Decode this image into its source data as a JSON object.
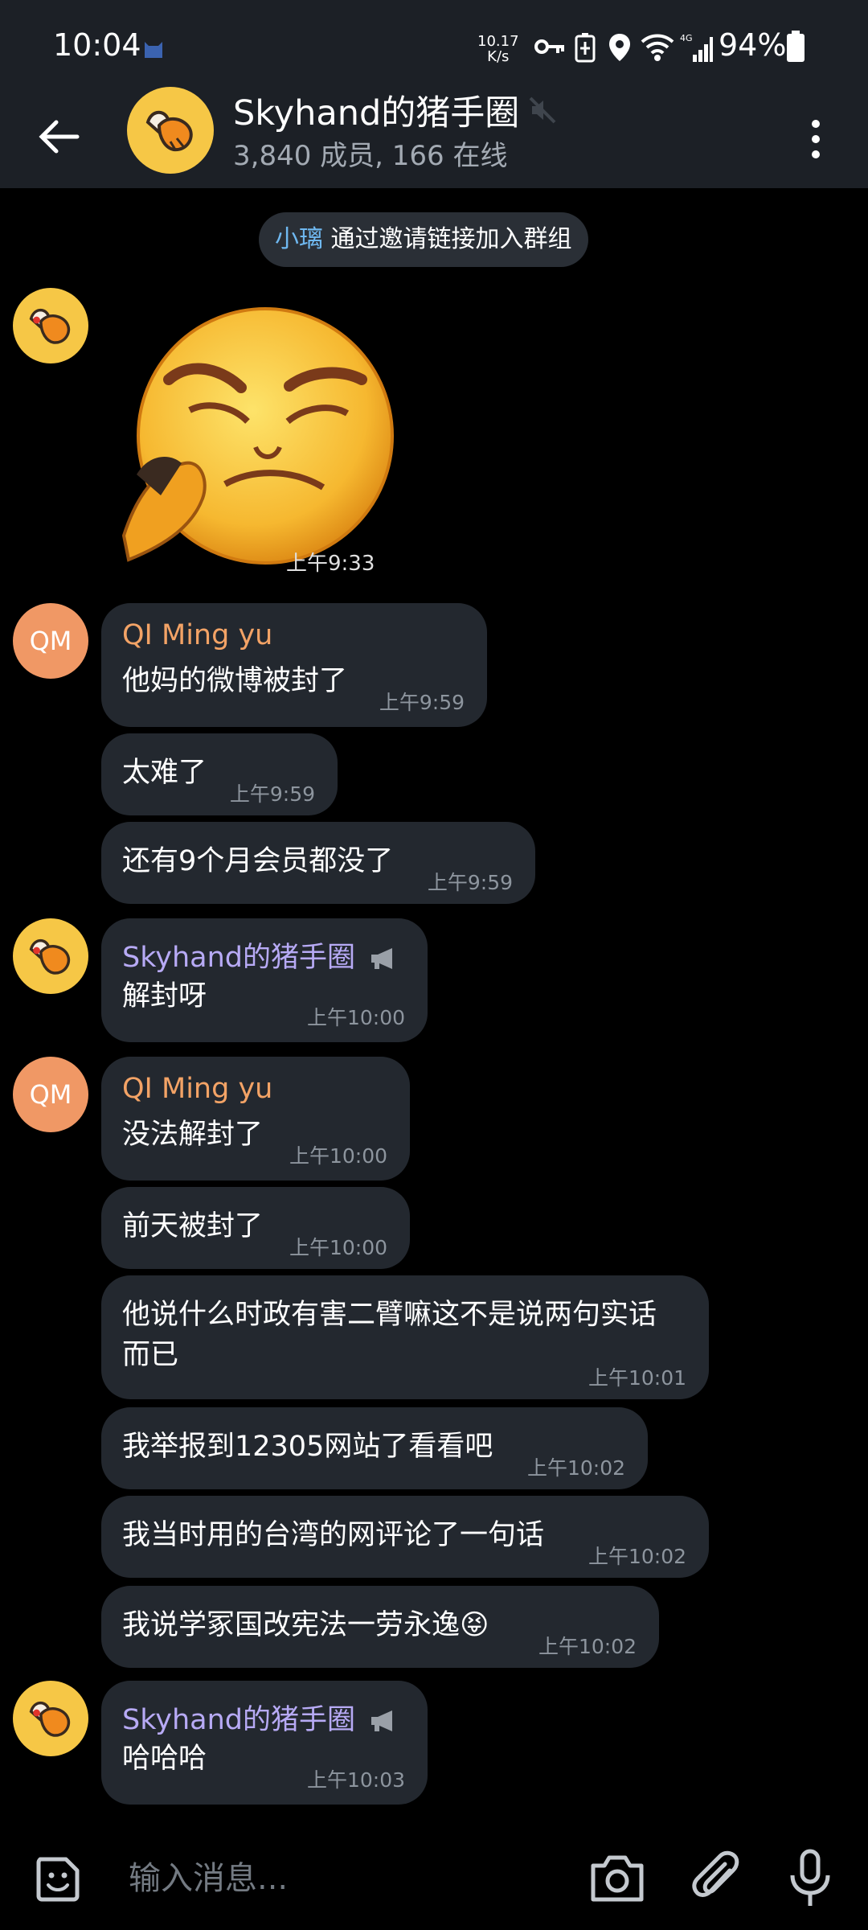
{
  "status_bar": {
    "time": "10:04",
    "net_speed_value": "10.17",
    "net_speed_unit": "K/s",
    "network": "4G",
    "battery": "94%"
  },
  "header": {
    "title": "Skyhand的猪手圈",
    "subtitle": "3,840 成员, 166 在线",
    "icons": [
      "back-arrow-icon",
      "mute-icon",
      "more-vert-icon"
    ]
  },
  "chat": {
    "service_message": {
      "name": "小璃",
      "text": "通过邀请链接加入群组"
    },
    "sticker": {
      "time": "上午9:33"
    },
    "messages": [
      {
        "sender": "QI Ming yu",
        "avatar": "QM",
        "text": "他妈的微博被封了",
        "time": "上午9:59"
      },
      {
        "text": "太难了",
        "time": "上午9:59"
      },
      {
        "text": "还有9个月会员都没了",
        "time": "上午9:59"
      },
      {
        "sender": "Skyhand的猪手圈",
        "text": "解封呀",
        "time": "上午10:00"
      },
      {
        "sender": "QI Ming yu",
        "avatar": "QM",
        "text": "没法解封了",
        "time": "上午10:00"
      },
      {
        "text": "前天被封了",
        "time": "上午10:00"
      },
      {
        "text_line1": "他说什么时政有害二臂嘛这不是说两句实话",
        "text_line2": "而已",
        "time": "上午10:01"
      },
      {
        "text": "我举报到12305网站了看看吧",
        "time": "上午10:02"
      },
      {
        "text": "我当时用的台湾的网评论了一句话",
        "time": "上午10:02"
      },
      {
        "text": "我说学冢国改宪法一劳永逸",
        "emoji": "😝",
        "time": "上午10:02"
      },
      {
        "sender": "Skyhand的猪手圈",
        "text": "哈哈哈",
        "time": "上午10:03"
      }
    ]
  },
  "composer": {
    "placeholder": "输入消息...",
    "icons": [
      "emoji-sticker-icon",
      "camera-icon",
      "paperclip-icon",
      "microphone-icon"
    ]
  },
  "colors": {
    "background": "#000000",
    "header": "#1c2026",
    "bubble": "#23282f",
    "sender_orange": "#f3a366",
    "sender_purple": "#b7aaf5",
    "link_blue": "#6fb8f0",
    "avatar_yellow": "#f6c746",
    "avatar_orange": "#f09865"
  }
}
